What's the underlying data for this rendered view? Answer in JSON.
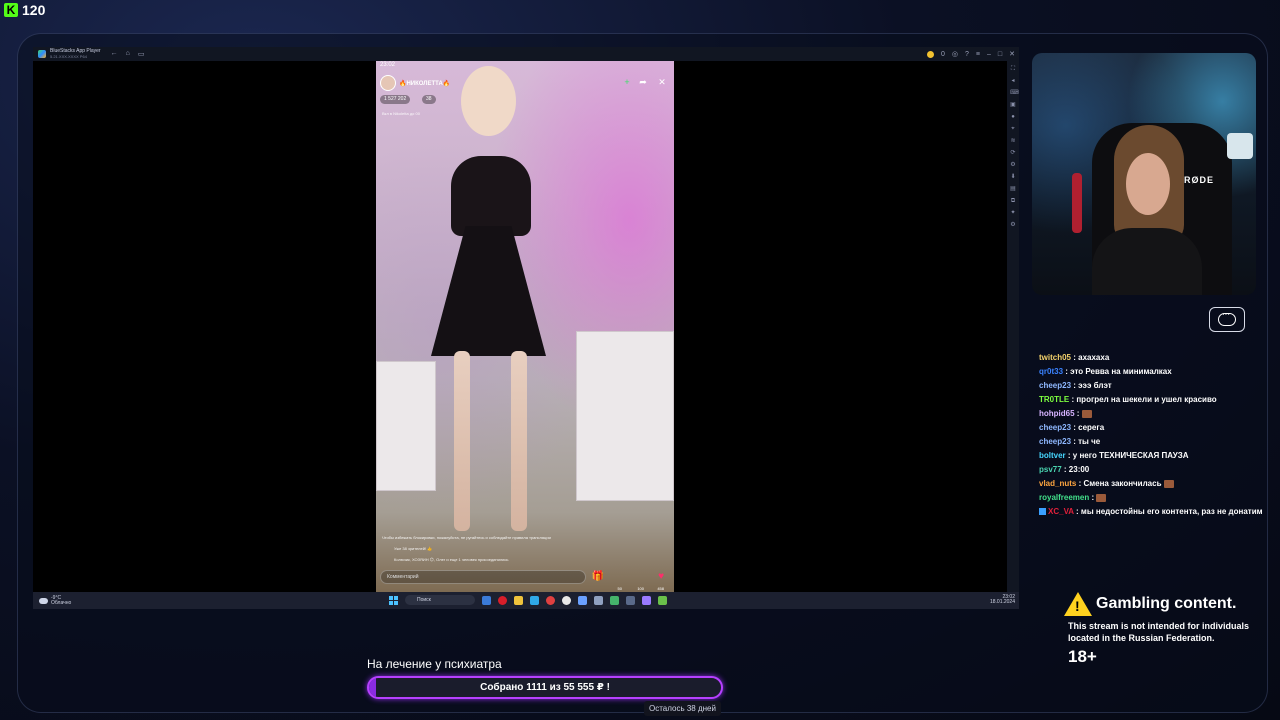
{
  "overlay": {
    "viewer_count": "120"
  },
  "bluestacks": {
    "title": "BlueStacks App Player",
    "subtitle": "5.21.XXX.XXXX P64",
    "coins": "0"
  },
  "phone": {
    "time": "23:02",
    "streamer_name": "🔥НИКОЛЕТТА🔥",
    "stat_1": "1 527 202",
    "stat_2": "38",
    "side_note": "Вкл в Nikoletta до 00",
    "notice_1": "Чтобы избежать блокировки, пожалуйста, не ругайтесь и соблюдайте правила трансляции",
    "notice_2": "Уже 38 зрителей! 👍",
    "notice_3": "Колючик, ХОЗЯИН 😊, Олег и еще 1 человек присоединились",
    "comment_placeholder": "Комментарий",
    "mini_1": "50",
    "mini_2": "100",
    "mini_3": "458"
  },
  "taskbar": {
    "weather_temp": "-9°C",
    "weather_desc": "Облачно",
    "search": "Поиск",
    "time": "23:02",
    "date": "18.01.2024"
  },
  "webcam": {
    "mic_brand": "RØDE"
  },
  "chat": [
    {
      "user": "twitch05",
      "color": "#f5d36b",
      "text": " : ахахаха"
    },
    {
      "user": "qr0t33",
      "color": "#3a82ff",
      "text": " : это Ревва на минималках"
    },
    {
      "user": "cheep23",
      "color": "#8fb8ff",
      "text": " : эээ блэт"
    },
    {
      "user": "TR0TLE",
      "color": "#7dff3f",
      "text": " : прогрел на шекели и ушел красиво"
    },
    {
      "user": "hohpid65",
      "color": "#d6b3ff",
      "text": " : ",
      "emote": true
    },
    {
      "user": "cheep23",
      "color": "#8fb8ff",
      "text": " : серега"
    },
    {
      "user": "cheep23",
      "color": "#8fb8ff",
      "text": " : ты че"
    },
    {
      "user": "boltver",
      "color": "#46d7ff",
      "text": " : у него ТЕХНИЧЕСКАЯ ПАУЗА"
    },
    {
      "user": "psv77",
      "color": "#4ad4b0",
      "text": " : 23:00"
    },
    {
      "user": "vlad_nuts",
      "color": "#ffa640",
      "text": " : Смена закончилась ",
      "emote": true
    },
    {
      "user": "royalfreemen",
      "color": "#42e08a",
      "text": " : ",
      "emote": true
    },
    {
      "user": "XC_VA",
      "color": "#e0203a",
      "text": " : мы недостойны его контента, раз не донатим",
      "badge": true
    }
  ],
  "gambling": {
    "title": "Gambling content.",
    "line1": "This stream is not intended for individuals",
    "line2": "located in the Russian Federation.",
    "age": "18+"
  },
  "goal": {
    "title": "На лечение у психиатра",
    "text": "Собрано 1111  из 55 555 ₽ !",
    "collected": 1111,
    "target": 55555,
    "remaining": "Осталось 38 дней"
  },
  "colors": {
    "accent": "#b640ff",
    "kick_green": "#53fc18",
    "warning": "#ffd21f"
  }
}
